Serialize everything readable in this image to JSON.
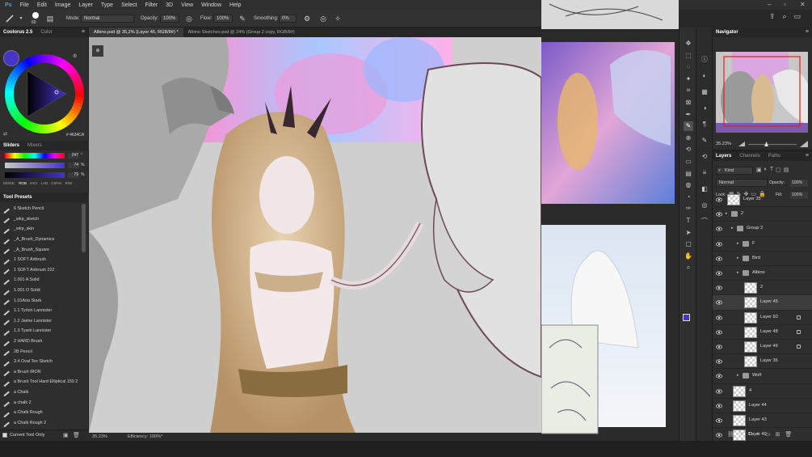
{
  "menubar": {
    "logo": "Ps",
    "items": [
      "File",
      "Edit",
      "Image",
      "Layer",
      "Type",
      "Select",
      "Filter",
      "3D",
      "View",
      "Window",
      "Help"
    ]
  },
  "options": {
    "brush_size": "60",
    "mode_label": "Mode:",
    "mode_value": "Normal",
    "opacity_label": "Opacity:",
    "opacity_value": "100%",
    "flow_label": "Flow:",
    "flow_value": "100%",
    "smoothing_label": "Smoothing:",
    "smoothing_value": "0%"
  },
  "colour_panel": {
    "tabs": [
      "Coolorus 2.5",
      "Color"
    ],
    "hex": "# 4634CA",
    "foreground_color": "#4634ca",
    "slider_tabs": [
      "Sliders",
      "Mixers"
    ],
    "sliders": [
      {
        "value": "247",
        "unit": "°"
      },
      {
        "value": "74",
        "unit": "%"
      },
      {
        "value": "79",
        "unit": "%"
      }
    ],
    "modes_label": "MODE:",
    "modes": [
      "RGB",
      "HSV",
      "LAB",
      "CMYK",
      "R/W"
    ]
  },
  "tool_presets": {
    "title": "Tool Presets",
    "items": [
      "6 Sketch Pencil",
      "_wkp_sketch",
      "_wkp_skin",
      "_A_Brush_Dynamics",
      "_A_Brush_Square",
      "1 SOFT Airbrush",
      "1 SOFT Airbrush 222",
      "1.001 A Solid",
      "1.001 O Solid",
      "1.01Aria Stark",
      "1.1 Tyrion Lannister",
      "1.2 Jaime Lannister",
      "1.3 Tywin Lannister",
      "2 HARD Brush",
      "2B Pencil",
      "3.4 Oval Tex Sketch",
      "a Brush IRON",
      "a Brush Tool Hard Elliptical 150 2",
      "a Chalk",
      "a chalk 2",
      "a Chalk Rough",
      "a Chalk Rough 2"
    ],
    "current_tool_only": "Current Tool Only"
  },
  "doc_tabs": [
    {
      "label": "Albino.psd @ 35,2% (Layer 45, RGB/8#) *",
      "active": true
    },
    {
      "label": "Albino Sketches.psd @ 24% (Group 2 copy, RGB/8#)",
      "active": false
    }
  ],
  "status": {
    "zoom": "35.23%",
    "efficiency": "Efficiency: 100%*"
  },
  "navigator": {
    "title": "Navigator",
    "zoom": "35.23%"
  },
  "layers_panel": {
    "tabs": [
      "Layers",
      "Channels",
      "Paths"
    ],
    "kind_label": "Kind",
    "blend_mode": "Normal",
    "opacity_label": "Opacity:",
    "opacity_value": "100%",
    "lock_label": "Lock:",
    "fill_label": "Fill:",
    "fill_value": "100%",
    "layers": [
      {
        "name": "Layer 35",
        "type": "layer",
        "indent": 0
      },
      {
        "name": "2",
        "type": "folder",
        "indent": 0
      },
      {
        "name": "Group 2",
        "type": "folder",
        "indent": 1
      },
      {
        "name": "F",
        "type": "folder",
        "indent": 2
      },
      {
        "name": "Bird",
        "type": "folder",
        "indent": 2
      },
      {
        "name": "Albino",
        "type": "folder",
        "indent": 2
      },
      {
        "name": "2",
        "type": "layer",
        "indent": 3
      },
      {
        "name": "Layer 45",
        "type": "layer",
        "indent": 3,
        "selected": true
      },
      {
        "name": "Layer 50",
        "type": "layer",
        "indent": 3,
        "locked": true
      },
      {
        "name": "Layer 48",
        "type": "layer",
        "indent": 3,
        "locked": true
      },
      {
        "name": "Layer 49",
        "type": "layer",
        "indent": 3,
        "locked": true
      },
      {
        "name": "Layer 36",
        "type": "layer",
        "indent": 3
      },
      {
        "name": "Wolf",
        "type": "folder",
        "indent": 2
      },
      {
        "name": "4",
        "type": "layer",
        "indent": 1
      },
      {
        "name": "Layer 44",
        "type": "layer",
        "indent": 1
      },
      {
        "name": "Layer 43",
        "type": "layer",
        "indent": 1
      },
      {
        "name": "Layer 40",
        "type": "layer",
        "indent": 1
      }
    ]
  }
}
